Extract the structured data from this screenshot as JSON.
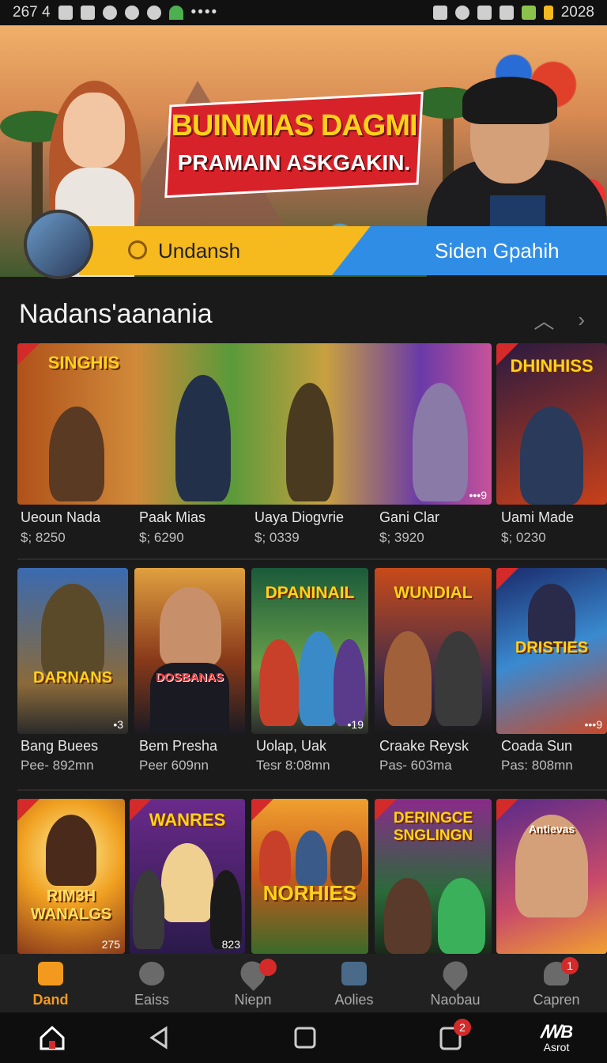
{
  "status_bar": {
    "time_left": "267 4",
    "time_right": "2028",
    "dots": "••••"
  },
  "hero": {
    "banner_line1": "BUINMIAS DAGMI",
    "banner_line2": "PRAMAIN ASKGAKIN.",
    "tab_left": "Undansh",
    "tab_right": "Siden Gpahih"
  },
  "section": {
    "title": "Nadans'aanania"
  },
  "row1": [
    {
      "thumb_title": "SINGHIS",
      "title": "Ueoun Nada",
      "price": "$; 8250"
    },
    {
      "thumb_title": "",
      "title": "Paak Mias",
      "price": "$; 6290"
    },
    {
      "thumb_title": "",
      "title": "Uaya Diogvrie",
      "price": "$; 0339"
    },
    {
      "thumb_title": "",
      "title": "Gani Clar",
      "price": "$; 3920",
      "count": "•••9"
    },
    {
      "thumb_title": "DHINHISS",
      "title": "Uami Made",
      "price": "$; 0230"
    }
  ],
  "row2": [
    {
      "thumb_title": "DARNANS",
      "title": "Bang Buees",
      "price": "Pee- 892mn",
      "count": "•3"
    },
    {
      "thumb_title": "DOSBANAS",
      "title": "Bem Presha",
      "price": "Peer 609nn"
    },
    {
      "thumb_title": "DPANINAIL",
      "title": "Uolap, Uak",
      "price": "Tesr 8:08mn",
      "count": "•19"
    },
    {
      "thumb_title": "WUNDIAL",
      "title": "Craake Reysk",
      "price": "Pas- 603ma"
    },
    {
      "thumb_title": "DRISTIES",
      "title": "Coada Sun",
      "price": "Pas: 808mn",
      "count": "•••9"
    }
  ],
  "row3": [
    {
      "thumb_title": "RIM3H WANALGS",
      "count": "275"
    },
    {
      "thumb_title": "WANRES",
      "count": "823"
    },
    {
      "thumb_title": "NORHIES",
      "count": ""
    },
    {
      "thumb_title": "DERINGCE SNGLINGN",
      "count": ""
    },
    {
      "thumb_title": "Antievas",
      "count": ""
    }
  ],
  "bottom_nav": [
    {
      "label": "Dand",
      "icon": "home-icon",
      "active": true
    },
    {
      "label": "Eaiss",
      "icon": "chat-icon"
    },
    {
      "label": "Niepn",
      "icon": "heart-icon",
      "badge": ""
    },
    {
      "label": "Aolies",
      "icon": "book-icon"
    },
    {
      "label": "Naobau",
      "icon": "location-icon"
    },
    {
      "label": "Capren",
      "icon": "profile-icon",
      "badge": "1"
    }
  ],
  "system_nav": {
    "apps_badge": "2",
    "brand": "Asrot"
  },
  "colors": {
    "accent": "#f39a1e",
    "bg": "#1a1a1a",
    "tab_yellow": "#f6b91e",
    "tab_blue": "#2f8de6",
    "badge_red": "#d42a2a"
  }
}
